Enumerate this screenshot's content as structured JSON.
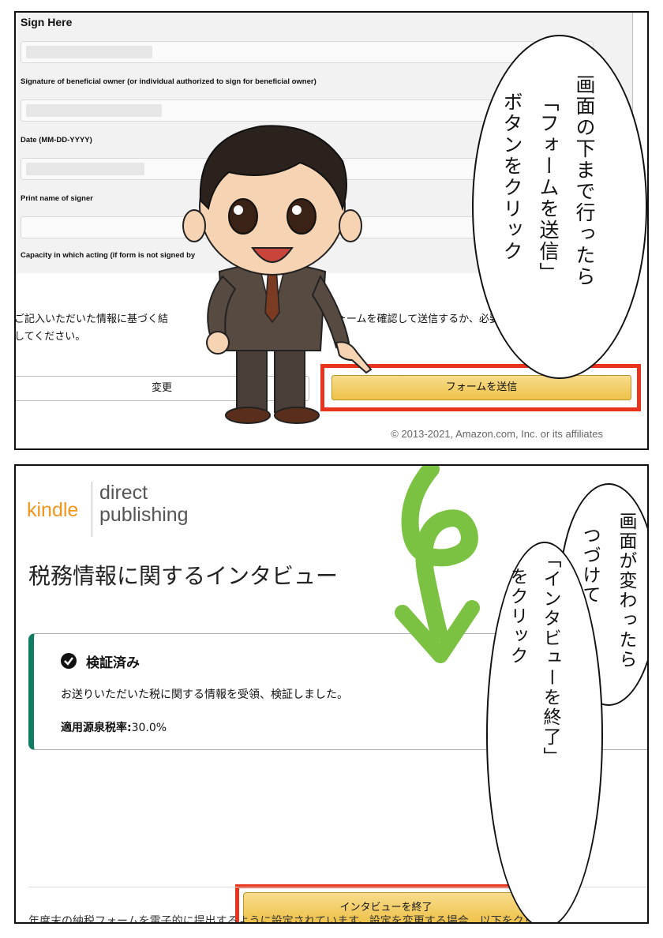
{
  "panel1": {
    "form": {
      "section_title": "Sign Here",
      "labels": [
        "Signature of beneficial owner (or individual authorized to sign for beneficial owner)",
        "Date (MM-DD-YYYY)",
        "Print name of signer",
        "Capacity in which acting (if form is not signed by"
      ]
    },
    "notice_line1": "ご記入いただいた情報に基づく結",
    "notice_line1b": "ーです。フォームを確認して送信するか、必要に応じて変更",
    "notice_line2": "してください。",
    "change_button": "変更",
    "submit_button": "フォームを送信",
    "copyright": "© 2013-2021, Amazon.com, Inc. or its affiliates",
    "bubble_lines": [
      "画面の下まで行ったら",
      "「フォームを送信」",
      "ボタンをクリック"
    ]
  },
  "panel2": {
    "logo_kindle": "kindle",
    "logo_direct": "direct",
    "logo_publishing": "publishing",
    "page_title": "税務情報に関するインタビュー",
    "status_title": "検証済み",
    "status_message": "お送りいただいた税に関する情報を受領、検証しました。",
    "rate_label": "適用源泉税率:",
    "rate_value": "30.0%",
    "end_button": "インタビューを終了",
    "cut_text": "年度末の納税フォームを電子的に提出するように設定されています。設定を変更する場合、以下をクリ",
    "bubble1_lines": [
      "画面が変わったら",
      "つづけて"
    ],
    "bubble2_lines": [
      "「インタビューを終了」",
      "をクリック"
    ]
  },
  "colors": {
    "highlight_frame": "#e8341c",
    "button_gold": "#efc248",
    "verified_green": "#0f7d62",
    "arrow_green": "#7cc242",
    "kindle_orange": "#f0961c"
  },
  "icons": [
    "check-circle-icon",
    "curly-arrow-icon",
    "businessman-character"
  ]
}
